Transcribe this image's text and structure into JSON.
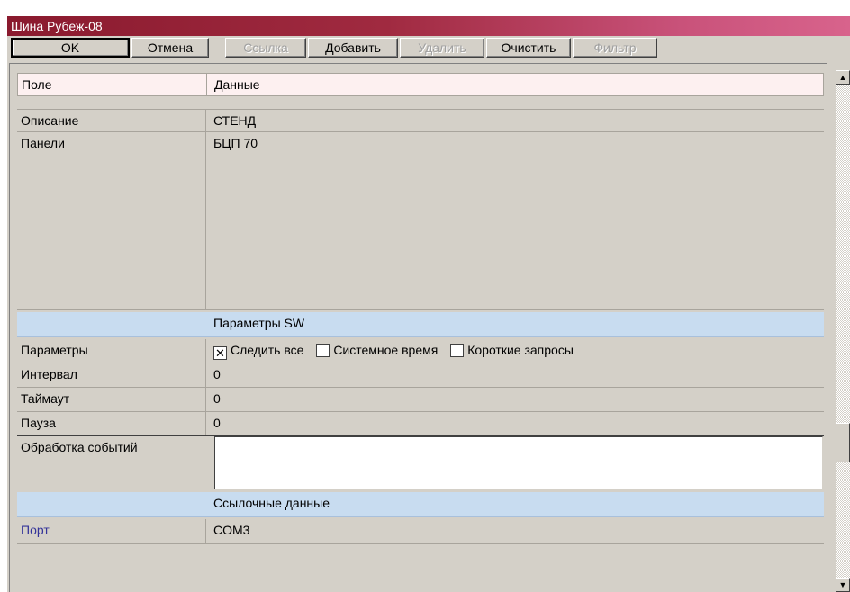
{
  "window": {
    "title": "Шина Рубеж-08"
  },
  "toolbar": {
    "ok": "OK",
    "cancel": "Отмена",
    "link": "Ссылка",
    "add": "Добавить",
    "delete": "Удалить",
    "clear": "Очистить",
    "filter": "Фильтр"
  },
  "grid": {
    "header": {
      "field": "Поле",
      "data": "Данные"
    },
    "description": {
      "label": "Описание",
      "value": "СТЕНД"
    },
    "panels": {
      "label": "Панели",
      "value": "БЦП 70"
    },
    "section_sw": "Параметры SW",
    "params": {
      "label": "Параметры",
      "options": [
        {
          "label": "Следить все",
          "checked": true
        },
        {
          "label": "Системное время",
          "checked": false
        },
        {
          "label": "Короткие запросы",
          "checked": false
        }
      ]
    },
    "interval": {
      "label": "Интервал",
      "value": "0"
    },
    "timeout": {
      "label": "Таймаут",
      "value": "0"
    },
    "pause": {
      "label": "Пауза",
      "value": "0"
    },
    "events": {
      "label": "Обработка событий",
      "value": ""
    },
    "section_ref": "Ссылочные данные",
    "port": {
      "label": "Порт",
      "value": "COM3"
    }
  },
  "colors": {
    "title_gradient_start": "#8a1a2e",
    "title_gradient_end": "#d8638c",
    "section_bg": "#c8dcf0",
    "header_bg": "#fdf0f0",
    "link_label": "#333399"
  },
  "icons": {
    "scroll_up": "arrow-up-icon",
    "scroll_down": "arrow-down-icon",
    "check": "check-x-icon"
  }
}
